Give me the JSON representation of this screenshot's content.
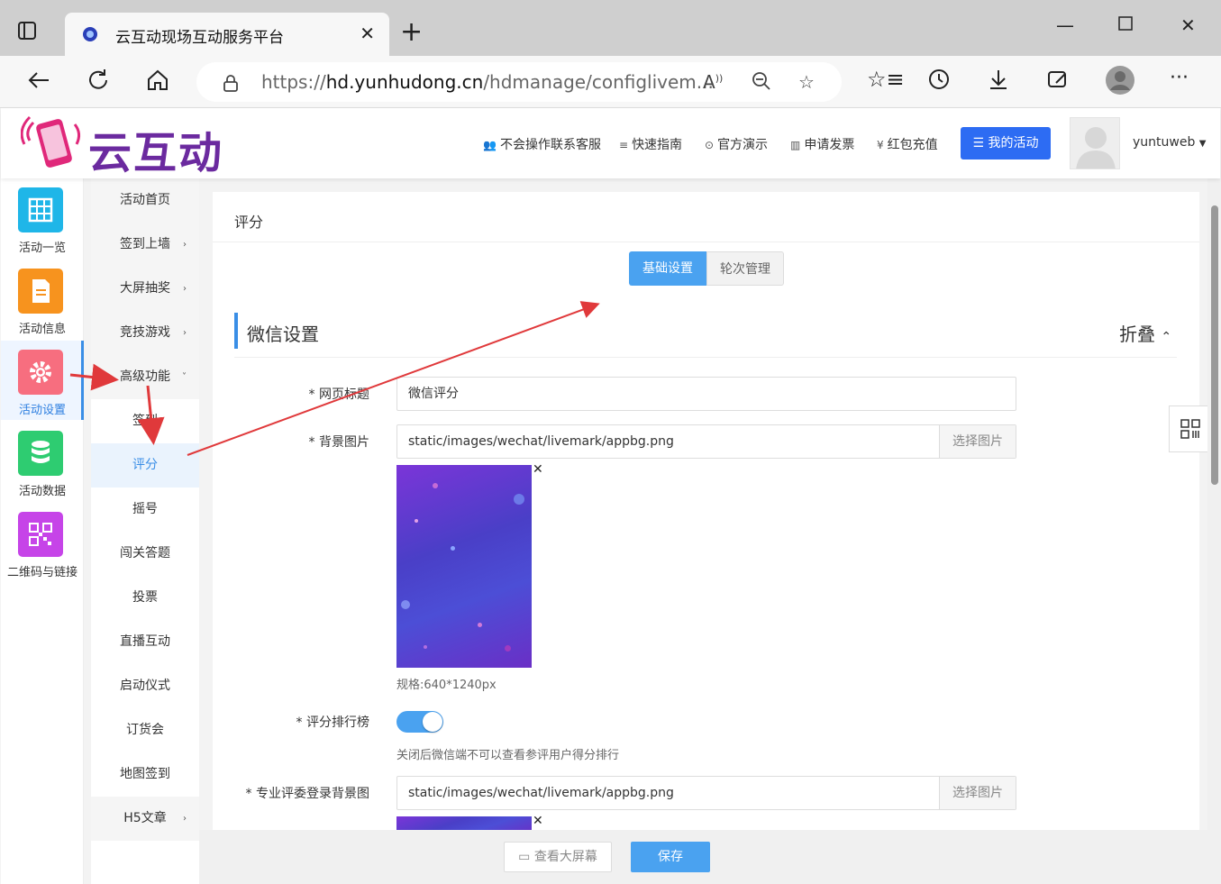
{
  "browser": {
    "tab_title": "云互动现场互动服务平台",
    "url_prefix": "https://",
    "url_host": "hd.yunhudong.cn",
    "url_path": "/hdmanage/configlivem..."
  },
  "header": {
    "logo_text": "云互动",
    "nav": [
      {
        "icon": "user-plus-icon",
        "label": "不会操作联系客服"
      },
      {
        "icon": "list-icon",
        "label": "快速指南"
      },
      {
        "icon": "play-circle-icon",
        "label": "官方演示"
      },
      {
        "icon": "barcode-icon",
        "label": "申请发票"
      },
      {
        "icon": "yen-icon",
        "label": "红包充值"
      }
    ],
    "my_activity": "我的活动",
    "username": "yuntuweb"
  },
  "iconbar": [
    {
      "label": "活动一览",
      "color": "#1fb6e8",
      "icon": "grid-icon"
    },
    {
      "label": "活动信息",
      "color": "#f7931e",
      "icon": "document-icon"
    },
    {
      "label": "活动设置",
      "color": "#f76e7f",
      "icon": "gear-icon"
    },
    {
      "label": "活动数据",
      "color": "#2ecc71",
      "icon": "database-icon"
    },
    {
      "label": "二维码与链接",
      "color": "#c644e8",
      "icon": "qrcode-icon"
    }
  ],
  "submenu": [
    {
      "label": "活动首页",
      "chev": ""
    },
    {
      "label": "签到上墙",
      "chev": "›"
    },
    {
      "label": "大屏抽奖",
      "chev": "›"
    },
    {
      "label": "竞技游戏",
      "chev": "›"
    },
    {
      "label": "高级功能",
      "chev": "˅"
    },
    {
      "label": "签到",
      "chev": ""
    },
    {
      "label": "评分",
      "chev": ""
    },
    {
      "label": "摇号",
      "chev": ""
    },
    {
      "label": "闯关答题",
      "chev": ""
    },
    {
      "label": "投票",
      "chev": ""
    },
    {
      "label": "直播互动",
      "chev": ""
    },
    {
      "label": "启动仪式",
      "chev": ""
    },
    {
      "label": "订货会",
      "chev": ""
    },
    {
      "label": "地图签到",
      "chev": ""
    },
    {
      "label": "H5文章",
      "chev": "›"
    }
  ],
  "main": {
    "title": "评分",
    "seg_basic": "基础设置",
    "seg_rounds": "轮次管理",
    "section_title": "微信设置",
    "fold": "折叠",
    "fields": {
      "page_title_label": "* 网页标题",
      "page_title_value": "微信评分",
      "bg_label": "* 背景图片",
      "bg_value": "static/images/wechat/livemark/appbg.png",
      "pick": "选择图片",
      "spec": "规格:640*1240px",
      "rank_label": "* 评分排行榜",
      "rank_hint": "关闭后微信端不可以查看参评用户得分排行",
      "judge_bg_label": "* 专业评委登录背景图",
      "judge_bg_value": "static/images/wechat/livemark/appbg.png"
    },
    "rank_enabled": true
  },
  "bottom": {
    "view_big_screen": "查看大屏幕",
    "save": "保存"
  },
  "colors": {
    "accent": "#3a8ee6",
    "primary_btn": "#2d6cf3",
    "arrow": "#e0393b"
  }
}
